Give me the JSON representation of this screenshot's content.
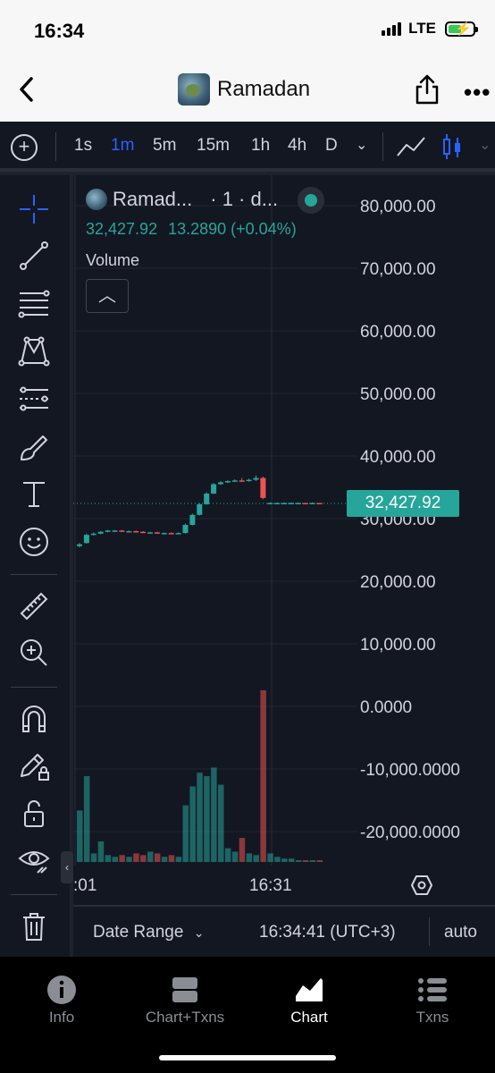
{
  "status_bar": {
    "time": "16:34",
    "network": "LTE"
  },
  "nav": {
    "title": "Ramadan",
    "back_icon": "chevron-left-icon",
    "share_icon": "share-icon",
    "more_icon": "more-icon"
  },
  "toolbar": {
    "timeframes": [
      "1s",
      "1m",
      "5m",
      "15m",
      "1h",
      "4h",
      "D"
    ],
    "active_timeframe": "1m"
  },
  "legend": {
    "name": "Ramad...",
    "symbol": "· 1 · d...",
    "price": "32,427.92",
    "change": "13.2890 (+0.04%)",
    "volume_label": "Volume"
  },
  "colors": {
    "up": "#26a69a",
    "down": "#ef5350",
    "accent": "#2962ff",
    "background": "#131722"
  },
  "chart_data": {
    "type": "candlestick",
    "price_axis_labels": [
      "80,000.00",
      "70,000.00",
      "60,000.00",
      "50,000.00",
      "40,000.00",
      "30,000.00",
      "20,000.00",
      "10,000.00",
      "0.0000",
      "-10,000.0000",
      "-20,000.0000"
    ],
    "price_ticks": [
      80000,
      70000,
      60000,
      50000,
      40000,
      30000,
      20000,
      10000,
      0,
      -10000,
      -20000
    ],
    "ylim": [
      -25500,
      82000
    ],
    "last_price": 32427.92,
    "last_price_label": "32,427.92",
    "x_labels": [
      ":01",
      "16:31"
    ],
    "candles": [
      {
        "o": 25600,
        "c": 25900,
        "h": 26100,
        "l": 25400
      },
      {
        "o": 26100,
        "c": 27400,
        "h": 27600,
        "l": 26000
      },
      {
        "o": 27400,
        "c": 27600,
        "h": 27800,
        "l": 27300
      },
      {
        "o": 27600,
        "c": 27900,
        "h": 28000,
        "l": 27500
      },
      {
        "o": 27900,
        "c": 28100,
        "h": 28200,
        "l": 27800
      },
      {
        "o": 28100,
        "c": 28100,
        "h": 28200,
        "l": 28000
      },
      {
        "o": 28100,
        "c": 28000,
        "h": 28200,
        "l": 27900
      },
      {
        "o": 28000,
        "c": 28000,
        "h": 28100,
        "l": 27900
      },
      {
        "o": 28000,
        "c": 27900,
        "h": 28100,
        "l": 27800
      },
      {
        "o": 27900,
        "c": 27800,
        "h": 28000,
        "l": 27700
      },
      {
        "o": 27800,
        "c": 27800,
        "h": 27900,
        "l": 27700
      },
      {
        "o": 27800,
        "c": 27700,
        "h": 27900,
        "l": 27600
      },
      {
        "o": 27700,
        "c": 27700,
        "h": 27800,
        "l": 27600
      },
      {
        "o": 27700,
        "c": 27600,
        "h": 27800,
        "l": 27500
      },
      {
        "o": 27600,
        "c": 27700,
        "h": 27800,
        "l": 27500
      },
      {
        "o": 27700,
        "c": 29000,
        "h": 29200,
        "l": 27600
      },
      {
        "o": 29000,
        "c": 30600,
        "h": 30800,
        "l": 28900
      },
      {
        "o": 30600,
        "c": 32300,
        "h": 32500,
        "l": 30500
      },
      {
        "o": 32300,
        "c": 34000,
        "h": 34200,
        "l": 32200
      },
      {
        "o": 34000,
        "c": 35500,
        "h": 35700,
        "l": 33900
      },
      {
        "o": 35500,
        "c": 35800,
        "h": 36000,
        "l": 35400
      },
      {
        "o": 35800,
        "c": 36000,
        "h": 36100,
        "l": 35700
      },
      {
        "o": 36000,
        "c": 36100,
        "h": 36300,
        "l": 35900
      },
      {
        "o": 36100,
        "c": 36000,
        "h": 36500,
        "l": 35900
      },
      {
        "o": 36000,
        "c": 36200,
        "h": 36400,
        "l": 35900
      },
      {
        "o": 36200,
        "c": 36500,
        "h": 36900,
        "l": 36000
      },
      {
        "o": 36500,
        "c": 33300,
        "h": 36700,
        "l": 33100
      },
      {
        "o": 32400,
        "c": 32500,
        "h": 32600,
        "l": 32300
      },
      {
        "o": 32500,
        "c": 32500,
        "h": 32600,
        "l": 32400
      },
      {
        "o": 32400,
        "c": 32500,
        "h": 32600,
        "l": 32300
      },
      {
        "o": 32500,
        "c": 32500,
        "h": 32600,
        "l": 32400
      },
      {
        "o": 32500,
        "c": 32500,
        "h": 32600,
        "l": 32400
      },
      {
        "o": 32500,
        "c": 32400,
        "h": 32500,
        "l": 32300
      },
      {
        "o": 32400,
        "c": 32500,
        "h": 32600,
        "l": 32300
      },
      {
        "o": 32500,
        "c": 32400,
        "h": 32500,
        "l": 32300
      }
    ],
    "volume_relative": [
      0.3,
      0.5,
      0.05,
      0.12,
      0.04,
      0.03,
      0.04,
      0.03,
      0.05,
      0.04,
      0.06,
      0.05,
      0.03,
      0.04,
      0.03,
      0.33,
      0.44,
      0.52,
      0.5,
      0.55,
      0.45,
      0.08,
      0.06,
      0.14,
      0.05,
      0.04,
      1.0,
      0.05,
      0.03,
      0.02,
      0.02,
      0.01,
      0.01,
      0.01,
      0.01
    ]
  },
  "bottom": {
    "date_range": "Date Range",
    "time": "16:34:41 (UTC+3)",
    "mode": "auto"
  },
  "tabs": [
    {
      "label": "Info",
      "icon": "info-icon"
    },
    {
      "label": "Chart+Txns",
      "icon": "split-icon"
    },
    {
      "label": "Chart",
      "icon": "area-chart-icon",
      "active": true
    },
    {
      "label": "Txns",
      "icon": "list-icon"
    }
  ]
}
